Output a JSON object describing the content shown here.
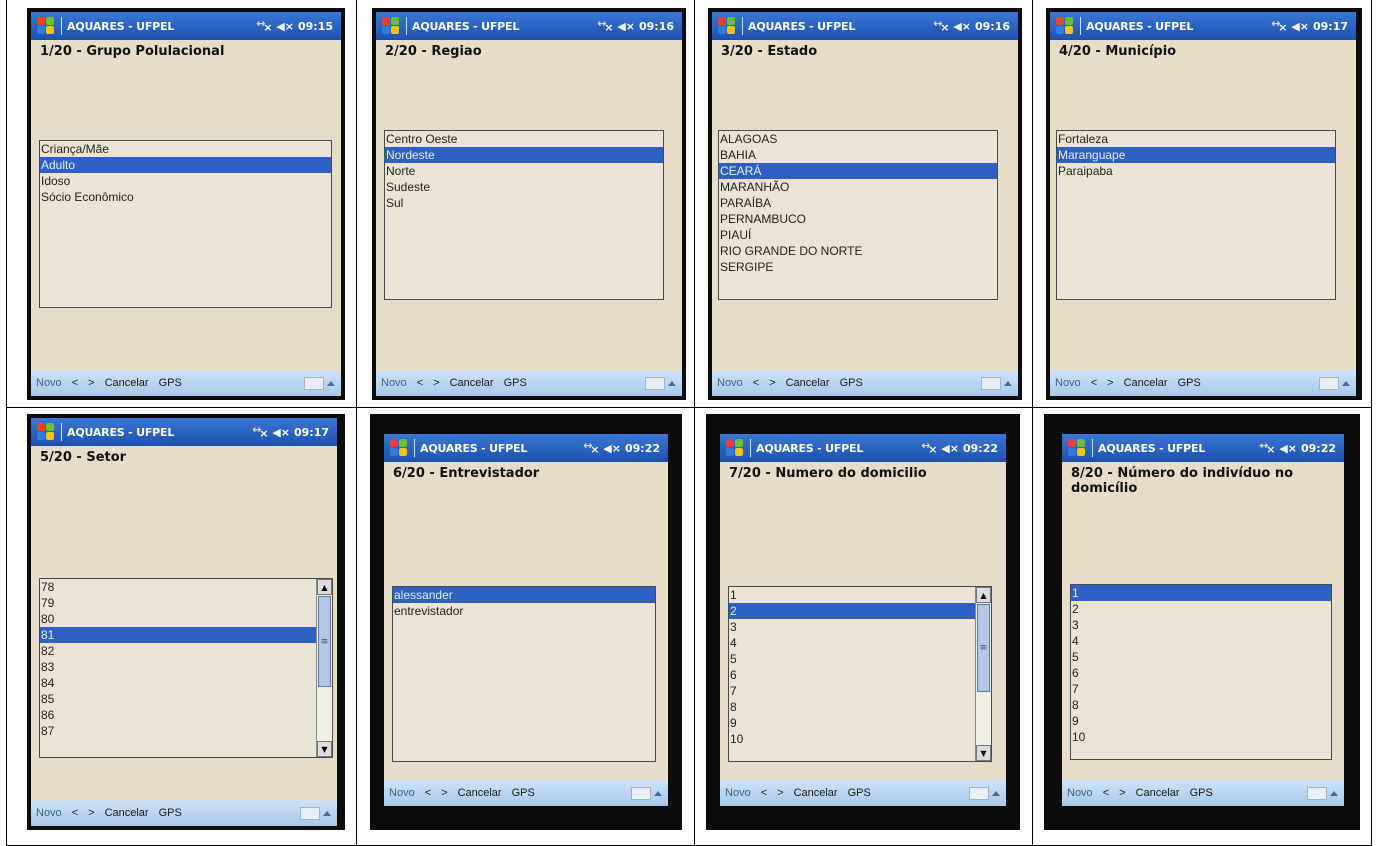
{
  "app_title": "AQUARES - UFPEL",
  "menu": {
    "novo": "Novo",
    "prev": "<",
    "next": ">",
    "cancel": "Cancelar",
    "gps": "GPS"
  },
  "screens": [
    {
      "time": "09:15",
      "question": "1/20 - Grupo Polulacional",
      "items": [
        "Criança/Mãe",
        "Adulto",
        "Idoso",
        "Sócio Econômico"
      ],
      "selected": 1,
      "scrollbar": false
    },
    {
      "time": "09:16",
      "question": "2/20 - Regiao",
      "items": [
        "Centro Oeste",
        "Nordeste",
        "Norte",
        "Sudeste",
        "Sul"
      ],
      "selected": 1,
      "scrollbar": false
    },
    {
      "time": "09:16",
      "question": "3/20 - Estado",
      "items": [
        "ALAGOAS",
        "BAHIA",
        "CEARÁ",
        "MARANHÃO",
        "PARAÍBA",
        "PERNAMBUCO",
        "PIAUÍ",
        "RIO GRANDE DO NORTE",
        "SERGIPE"
      ],
      "selected": 2,
      "scrollbar": false
    },
    {
      "time": "09:17",
      "question": "4/20 - Município",
      "items": [
        "Fortaleza",
        "Maranguape",
        "Paraipaba"
      ],
      "selected": 1,
      "scrollbar": false
    },
    {
      "time": "09:17",
      "question": "5/20 - Setor",
      "items": [
        "78",
        "79",
        "80",
        "81",
        "82",
        "83",
        "84",
        "85",
        "86",
        "87"
      ],
      "selected": 3,
      "scrollbar": true
    },
    {
      "time": "09:22",
      "question": "6/20 - Entrevistador",
      "items": [
        "alessander",
        "entrevistador"
      ],
      "selected": 0,
      "scrollbar": false
    },
    {
      "time": "09:22",
      "question": "7/20 - Numero do domicilio",
      "items": [
        "1",
        "2",
        "3",
        "4",
        "5",
        "6",
        "7",
        "8",
        "9",
        "10"
      ],
      "selected": 1,
      "scrollbar": true
    },
    {
      "time": "09:22",
      "question": "8/20 - Número do indivíduo no domicílio",
      "items": [
        "1",
        "2",
        "3",
        "4",
        "5",
        "6",
        "7",
        "8",
        "9",
        "10"
      ],
      "selected": 0,
      "scrollbar": false
    }
  ]
}
